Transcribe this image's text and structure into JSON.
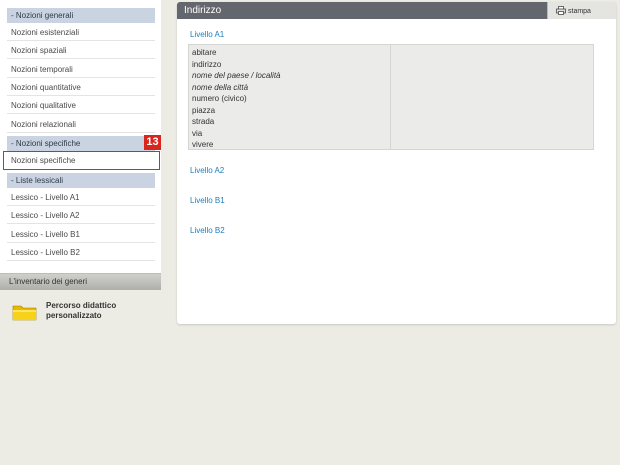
{
  "sidebar": {
    "sections": [
      {
        "header": "- Nozioni generali"
      },
      {
        "header": "- Nozioni specifiche"
      },
      {
        "header": "- Liste lessicali"
      }
    ],
    "general_items": [
      "Nozioni esistenziali",
      "Nozioni spaziali",
      "Nozioni temporali",
      "Nozioni quantitative",
      "Nozioni qualitative",
      "Nozioni relazionali"
    ],
    "specific_items": [
      "Nozioni specifiche"
    ],
    "lexicon_items": [
      "Lessico - Livello A1",
      "Lessico - Livello A2",
      "Lessico - Livello B1",
      "Lessico - Livello B2"
    ],
    "badge": "13",
    "inventory": "L'inventario dei generi",
    "percorso": "Percorso didattico personalizzato"
  },
  "main": {
    "title": "Indirizzo",
    "print_label": "stampa",
    "levels": [
      "Livello A1",
      "Livello A2",
      "Livello B1",
      "Livello B2"
    ],
    "words": [
      {
        "text": "abitare",
        "italic": false
      },
      {
        "text": "indirizzo",
        "italic": false
      },
      {
        "text": "nome del paese / località",
        "italic": true
      },
      {
        "text": "nome della città",
        "italic": true
      },
      {
        "text": "numero (civico)",
        "italic": false
      },
      {
        "text": "piazza",
        "italic": false
      },
      {
        "text": "strada",
        "italic": false
      },
      {
        "text": "via",
        "italic": false
      },
      {
        "text": "vivere",
        "italic": false
      }
    ]
  },
  "colors": {
    "section_header_bg": "#c9d3e1",
    "main_header_bg": "#63666c",
    "link": "#1e7dbe",
    "highlight_border": "#e0261b",
    "badge_bg": "#d9261c"
  }
}
